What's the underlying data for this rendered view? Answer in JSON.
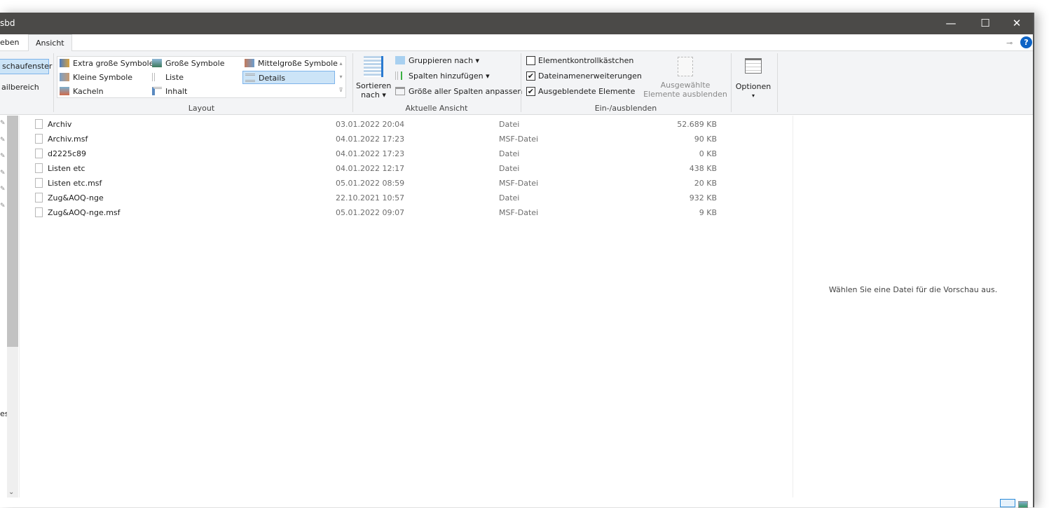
{
  "window": {
    "title": "sbd",
    "minimize": "—",
    "maximize": "☐",
    "close": "✕"
  },
  "tabs": [
    {
      "label": "eben"
    },
    {
      "label": "Ansicht"
    }
  ],
  "ribbon": {
    "panes": {
      "preview": "schaufenster",
      "details": "ailbereich"
    },
    "layout": {
      "items": [
        "Extra große Symbole",
        "Große Symbole",
        "Mittelgroße Symbole",
        "Kleine Symbole",
        "Liste",
        "Details",
        "Kacheln",
        "Inhalt"
      ],
      "selected": "Details",
      "group_label": "Layout"
    },
    "current_view": {
      "sort_label_1": "Sortieren",
      "sort_label_2": "nach",
      "group_by": "Gruppieren nach",
      "add_columns": "Spalten hinzufügen",
      "fit_columns": "Größe aller Spalten anpassen",
      "group_label": "Aktuelle Ansicht"
    },
    "show_hide": {
      "item_checkboxes": {
        "label": "Elementkontrollkästchen",
        "checked": false
      },
      "file_extensions": {
        "label": "Dateinamenerweiterungen",
        "checked": true
      },
      "hidden_items": {
        "label": "Ausgeblendete Elemente",
        "checked": true
      },
      "hide_selected_1": "Ausgewählte",
      "hide_selected_2": "Elemente ausblenden",
      "group_label": "Ein-/ausblenden"
    },
    "options": "Optionen"
  },
  "nav": {
    "partial_label": "es"
  },
  "files": [
    {
      "name": "Archiv",
      "date": "03.01.2022 20:04",
      "type": "Datei",
      "size": "52.689 KB"
    },
    {
      "name": "Archiv.msf",
      "date": "04.01.2022 17:23",
      "type": "MSF-Datei",
      "size": "90 KB"
    },
    {
      "name": "d2225c89",
      "date": "04.01.2022 17:23",
      "type": "Datei",
      "size": "0 KB"
    },
    {
      "name": "Listen etc",
      "date": "04.01.2022 12:17",
      "type": "Datei",
      "size": "438 KB"
    },
    {
      "name": "Listen etc.msf",
      "date": "05.01.2022 08:59",
      "type": "MSF-Datei",
      "size": "20 KB"
    },
    {
      "name": "Zug&AOQ-nge",
      "date": "22.10.2021 10:57",
      "type": "Datei",
      "size": "932 KB"
    },
    {
      "name": "Zug&AOQ-nge.msf",
      "date": "05.01.2022 09:07",
      "type": "MSF-Datei",
      "size": "9 KB"
    }
  ],
  "preview": {
    "message": "Wählen Sie eine Datei für die Vorschau aus."
  }
}
